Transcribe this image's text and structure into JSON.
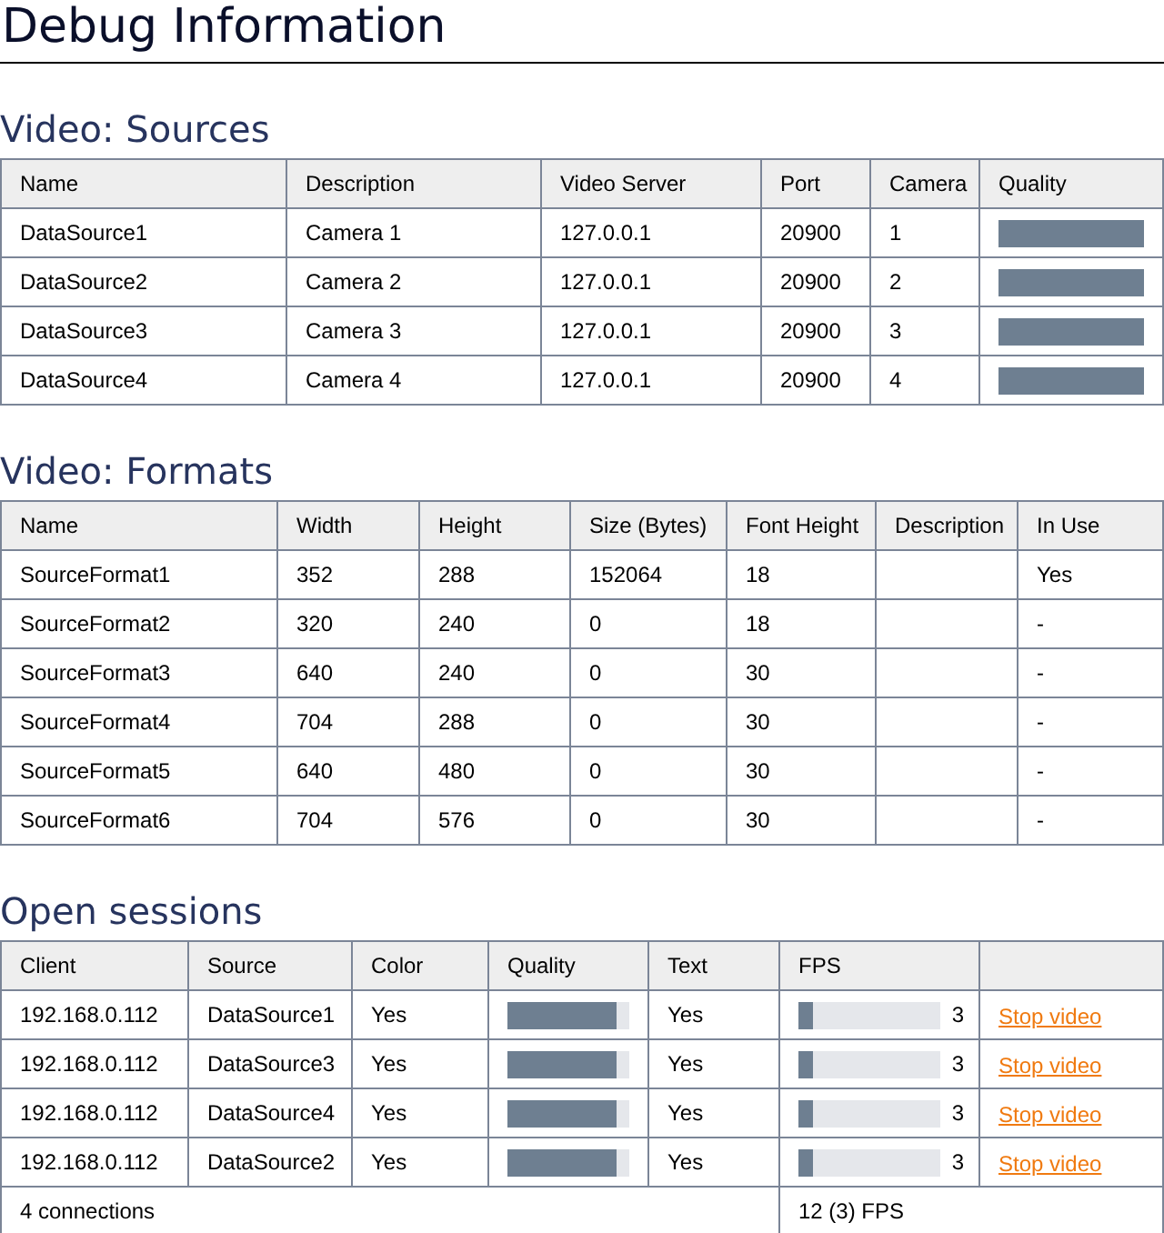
{
  "title": "Debug Information",
  "sources": {
    "heading": "Video: Sources",
    "columns": [
      "Name",
      "Description",
      "Video Server",
      "Port",
      "Camera",
      "Quality"
    ],
    "rows": [
      {
        "name": "DataSource1",
        "description": "Camera 1",
        "server": "127.0.0.1",
        "port": "20900",
        "camera": "1",
        "quality": {
          "level": 1
        }
      },
      {
        "name": "DataSource2",
        "description": "Camera 2",
        "server": "127.0.0.1",
        "port": "20900",
        "camera": "2",
        "quality": {
          "level": 1
        }
      },
      {
        "name": "DataSource3",
        "description": "Camera 3",
        "server": "127.0.0.1",
        "port": "20900",
        "camera": "3",
        "quality": {
          "level": 1
        }
      },
      {
        "name": "DataSource4",
        "description": "Camera 4",
        "server": "127.0.0.1",
        "port": "20900",
        "camera": "4",
        "quality": {
          "level": 1
        }
      }
    ]
  },
  "formats": {
    "heading": "Video: Formats",
    "columns": [
      "Name",
      "Width",
      "Height",
      "Size (Bytes)",
      "Font Height",
      "Description",
      "In Use"
    ],
    "rows": [
      [
        "SourceFormat1",
        "352",
        "288",
        "152064",
        "18",
        "",
        "Yes"
      ],
      [
        "SourceFormat2",
        "320",
        "240",
        "0",
        "18",
        "",
        "-"
      ],
      [
        "SourceFormat3",
        "640",
        "240",
        "0",
        "30",
        "",
        "-"
      ],
      [
        "SourceFormat4",
        "704",
        "288",
        "0",
        "30",
        "",
        "-"
      ],
      [
        "SourceFormat5",
        "640",
        "480",
        "0",
        "30",
        "",
        "-"
      ],
      [
        "SourceFormat6",
        "704",
        "576",
        "0",
        "30",
        "",
        "-"
      ]
    ]
  },
  "sessions": {
    "heading": "Open sessions",
    "columns": [
      "Client",
      "Source",
      "Color",
      "Quality",
      "Text",
      "FPS"
    ],
    "rows": [
      {
        "client": "192.168.0.112",
        "source": "DataSource1",
        "color_mode": "Yes",
        "quality": {
          "level": 0.9
        },
        "text": "Yes",
        "fps": {
          "level": 0.1,
          "reading": "3"
        },
        "action": "Stop video"
      },
      {
        "client": "192.168.0.112",
        "source": "DataSource3",
        "color_mode": "Yes",
        "quality": {
          "level": 0.9
        },
        "text": "Yes",
        "fps": {
          "level": 0.1,
          "reading": "3"
        },
        "action": "Stop video"
      },
      {
        "client": "192.168.0.112",
        "source": "DataSource4",
        "color_mode": "Yes",
        "quality": {
          "level": 0.9
        },
        "text": "Yes",
        "fps": {
          "level": 0.1,
          "reading": "3"
        },
        "action": "Stop video"
      },
      {
        "client": "192.168.0.112",
        "source": "DataSource2",
        "color_mode": "Yes",
        "quality": {
          "level": 0.9
        },
        "text": "Yes",
        "fps": {
          "level": 0.1,
          "reading": "3"
        },
        "action": "Stop video"
      }
    ],
    "footer": {
      "connections": "4 connections",
      "fps": "12 (3) FPS"
    }
  }
}
